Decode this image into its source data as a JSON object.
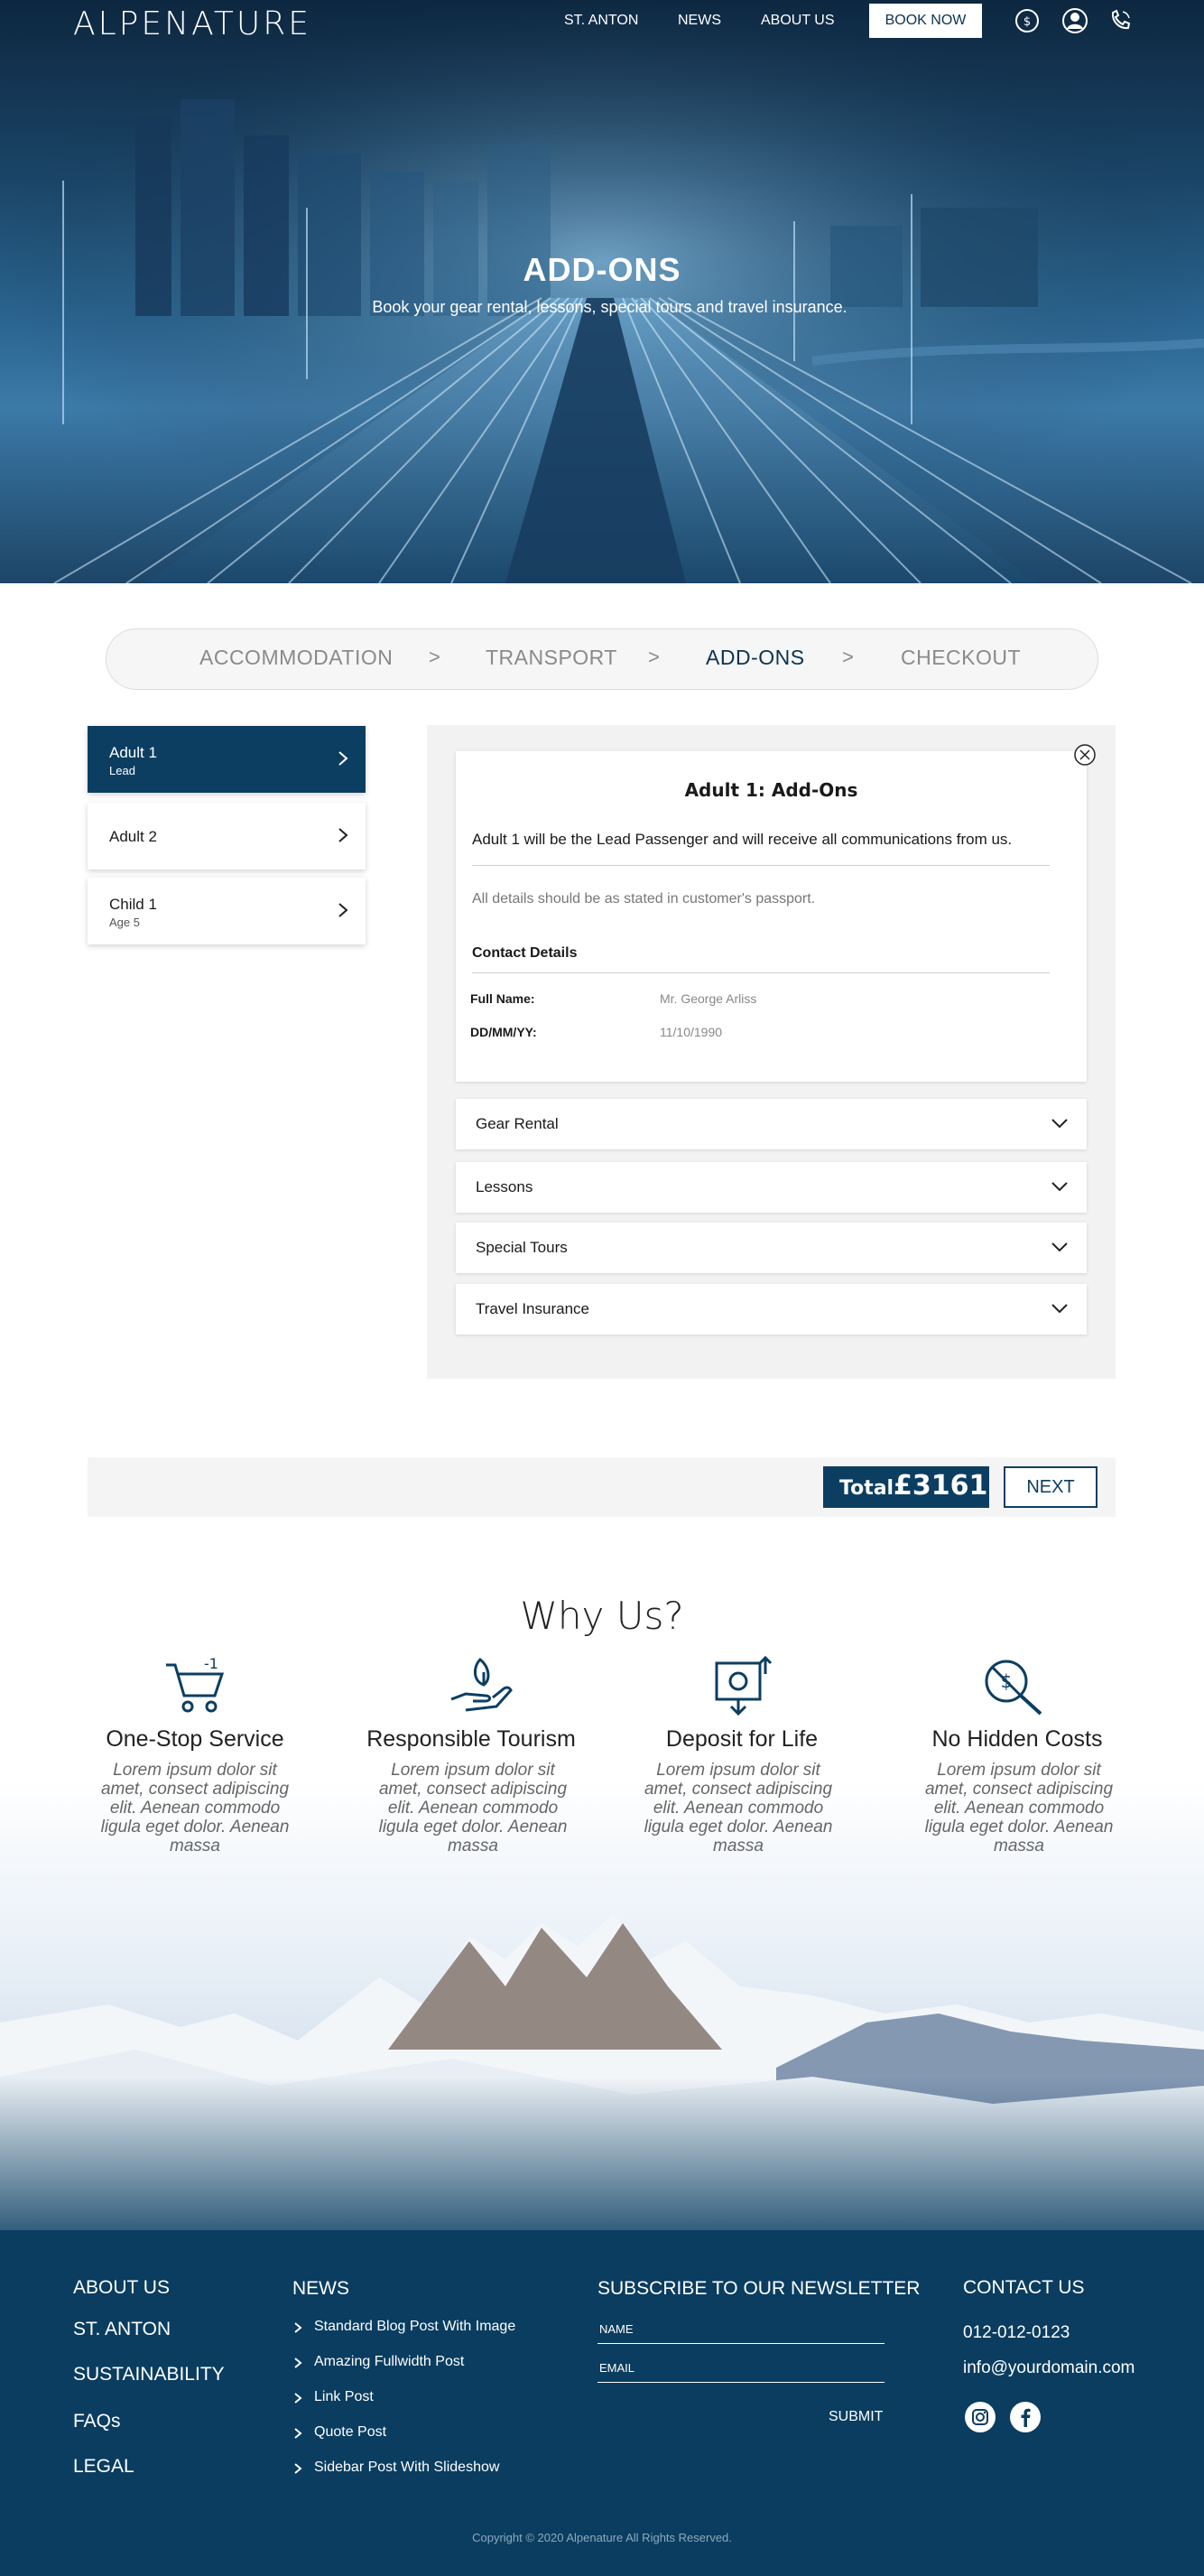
{
  "brand": {
    "logo": "ALPENATURE"
  },
  "nav": {
    "items": [
      "ST. ANTON",
      "NEWS",
      "ABOUT US"
    ],
    "book_now": "BOOK NOW",
    "icons": [
      "currency-exchange-icon",
      "user-account-icon",
      "phone-icon"
    ]
  },
  "hero": {
    "title": "ADD-ONS",
    "subtitle": "Book your gear rental, lessons, special tours and travel insurance."
  },
  "steps": {
    "items": [
      "ACCOMMODATION",
      "TRANSPORT",
      "ADD-ONS",
      "CHECKOUT"
    ],
    "separator": ">",
    "active": "ADD-ONS"
  },
  "passengers": [
    {
      "name": "Adult 1",
      "sub": "Lead",
      "active": true
    },
    {
      "name": "Adult 2",
      "sub": "",
      "active": false
    },
    {
      "name": "Child 1",
      "sub": "Age 5",
      "active": false
    }
  ],
  "details": {
    "title": "Adult 1: Add-Ons",
    "lead_text": "Adult 1 will be the Lead Passenger and will receive all communications from us.",
    "note": "All details should be as stated in customer's passport.",
    "contact_heading": "Contact Details",
    "fields": [
      {
        "label": "Full Name:",
        "value": "Mr. George Arliss"
      },
      {
        "label": "DD/MM/YY:",
        "value": "11/10/1990"
      }
    ]
  },
  "addons": [
    "Gear Rental",
    "Lessons",
    "Special Tours",
    "Travel Insurance"
  ],
  "total": {
    "label": "Total",
    "value": "£3161",
    "next": "NEXT"
  },
  "why": {
    "title": "Why Us?",
    "features": [
      {
        "title": "One-Stop Service",
        "desc": "Lorem ipsum dolor sit amet, consect adipiscing elit. Aenean commodo ligula eget dolor. Aenean massa",
        "icon": "shopping-cart-icon"
      },
      {
        "title": "Responsible Tourism",
        "desc": "Lorem ipsum dolor sit amet, consect adipiscing elit. Aenean commodo ligula eget dolor. Aenean massa",
        "icon": "hand-leaf-icon"
      },
      {
        "title": "Deposit for Life",
        "desc": "Lorem ipsum dolor sit amet, consect adipiscing elit. Aenean commodo ligula eget dolor. Aenean massa",
        "icon": "money-deposit-icon"
      },
      {
        "title": "No Hidden Costs",
        "desc": "Lorem ipsum dolor sit amet, consect adipiscing elit. Aenean commodo ligula eget dolor. Aenean massa",
        "icon": "no-hidden-cost-icon"
      }
    ]
  },
  "footer": {
    "links": [
      "ABOUT US",
      "ST. ANTON",
      "SUSTAINABILITY",
      "FAQs",
      "LEGAL"
    ],
    "news_heading": "NEWS",
    "news_items": [
      "Standard Blog Post With Image",
      "Amazing Fullwidth Post",
      "Link Post",
      "Quote Post",
      "Sidebar Post With Slideshow"
    ],
    "newsletter_heading": "SUBSCRIBE TO OUR NEWSLETTER",
    "name_label": "NAME",
    "email_label": "EMAIL",
    "submit": "SUBMIT",
    "contact_heading": "CONTACT US",
    "phone": "012-012-0123",
    "email": "info@yourdomain.com",
    "social": [
      "instagram-icon",
      "facebook-icon"
    ],
    "copyright": "Copyright © 2020  Alpenature  All Rights Reserved."
  },
  "colors": {
    "primary": "#0c3e62",
    "panel": "#f2f2f2",
    "footer": "#0a3d60"
  }
}
